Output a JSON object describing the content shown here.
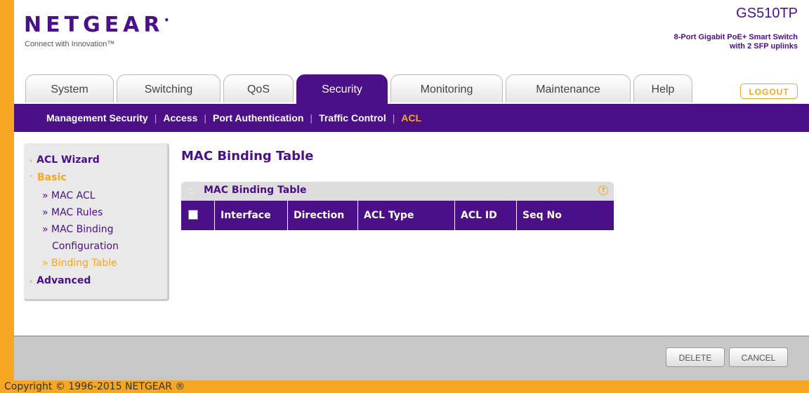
{
  "brand": {
    "logo": "NETGEAR",
    "tagline": "Connect with Innovation™",
    "model": "GS510TP",
    "model_desc_line1": "8-Port Gigabit PoE+ Smart Switch",
    "model_desc_line2": "with 2 SFP uplinks"
  },
  "tabs": [
    {
      "label": "System"
    },
    {
      "label": "Switching"
    },
    {
      "label": "QoS"
    },
    {
      "label": "Security",
      "active": true
    },
    {
      "label": "Monitoring"
    },
    {
      "label": "Maintenance"
    },
    {
      "label": "Help"
    }
  ],
  "logout_label": "LOGOUT",
  "subnav": [
    {
      "label": "Management Security"
    },
    {
      "label": "Access"
    },
    {
      "label": "Port Authentication"
    },
    {
      "label": "Traffic Control"
    },
    {
      "label": "ACL",
      "active": true
    }
  ],
  "subnav_separator": "|",
  "leftnav": {
    "acl_wizard": "ACL Wizard",
    "basic": "Basic",
    "mac_acl": "» MAC ACL",
    "mac_rules": "» MAC Rules",
    "mac_binding_1": "» MAC Binding",
    "mac_binding_2": "Configuration",
    "binding_table": "» Binding Table",
    "advanced": "Advanced"
  },
  "page_title": "MAC Binding Table",
  "panel": {
    "title": "MAC Binding Table",
    "help": "?",
    "columns": [
      "Interface",
      "Direction",
      "ACL Type",
      "ACL ID",
      "Seq No"
    ]
  },
  "buttons": {
    "delete": "DELETE",
    "cancel": "CANCEL"
  },
  "copyright": "Copyright © 1996-2015 NETGEAR ®",
  "colors": {
    "brand_purple": "#4b0f87",
    "accent_orange": "#f5a623"
  }
}
